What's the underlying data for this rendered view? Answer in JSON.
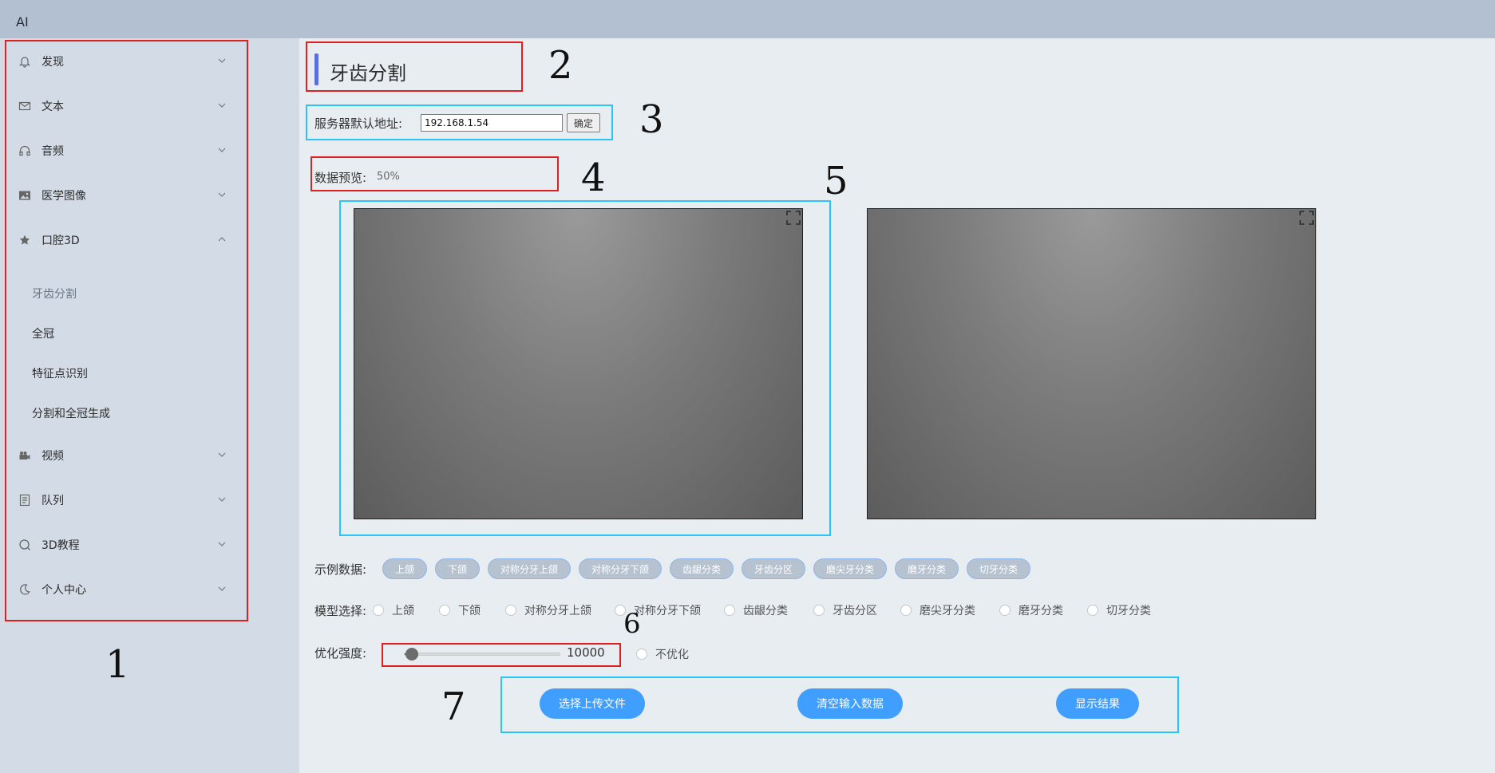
{
  "app": {
    "brand": "AI"
  },
  "sidebar": {
    "items": [
      {
        "label": "发现"
      },
      {
        "label": "文本"
      },
      {
        "label": "音频"
      },
      {
        "label": "医学图像"
      },
      {
        "label": "口腔3D"
      },
      {
        "label": "视频"
      },
      {
        "label": "队列"
      },
      {
        "label": "3D教程"
      },
      {
        "label": "个人中心"
      }
    ],
    "subitems": [
      {
        "label": "牙齿分割"
      },
      {
        "label": "全冠"
      },
      {
        "label": "特征点识别"
      },
      {
        "label": "分割和全冠生成"
      }
    ]
  },
  "main": {
    "title": "牙齿分割",
    "server": {
      "label": "服务器默认地址:",
      "value": "192.168.1.54",
      "confirm": "确定"
    },
    "preview": {
      "label": "数据预览:",
      "percent": "50%"
    },
    "examples": {
      "label": "示例数据:",
      "chips": [
        "上颌",
        "下颌",
        "对称分牙上颌",
        "对称分牙下颌",
        "齿龈分类",
        "牙齿分区",
        "磨尖牙分类",
        "磨牙分类",
        "切牙分类"
      ]
    },
    "models": {
      "label": "模型选择:",
      "options": [
        "上颌",
        "下颌",
        "对称分牙上颌",
        "对称分牙下颌",
        "齿龈分类",
        "牙齿分区",
        "磨尖牙分类",
        "磨牙分类",
        "切牙分类"
      ]
    },
    "optimize": {
      "label": "优化强度:",
      "value": "10000",
      "slider_fraction": 0.05,
      "no_opt": "不优化"
    },
    "actions": {
      "upload": "选择上传文件",
      "clear": "清空输入数据",
      "show": "显示结果"
    }
  },
  "annotations": [
    "1",
    "2",
    "3",
    "4",
    "5",
    "6",
    "7"
  ],
  "colors": {
    "accent": "#409eff",
    "annotation_red": "#e02020",
    "annotation_blue": "#29c5f6"
  }
}
